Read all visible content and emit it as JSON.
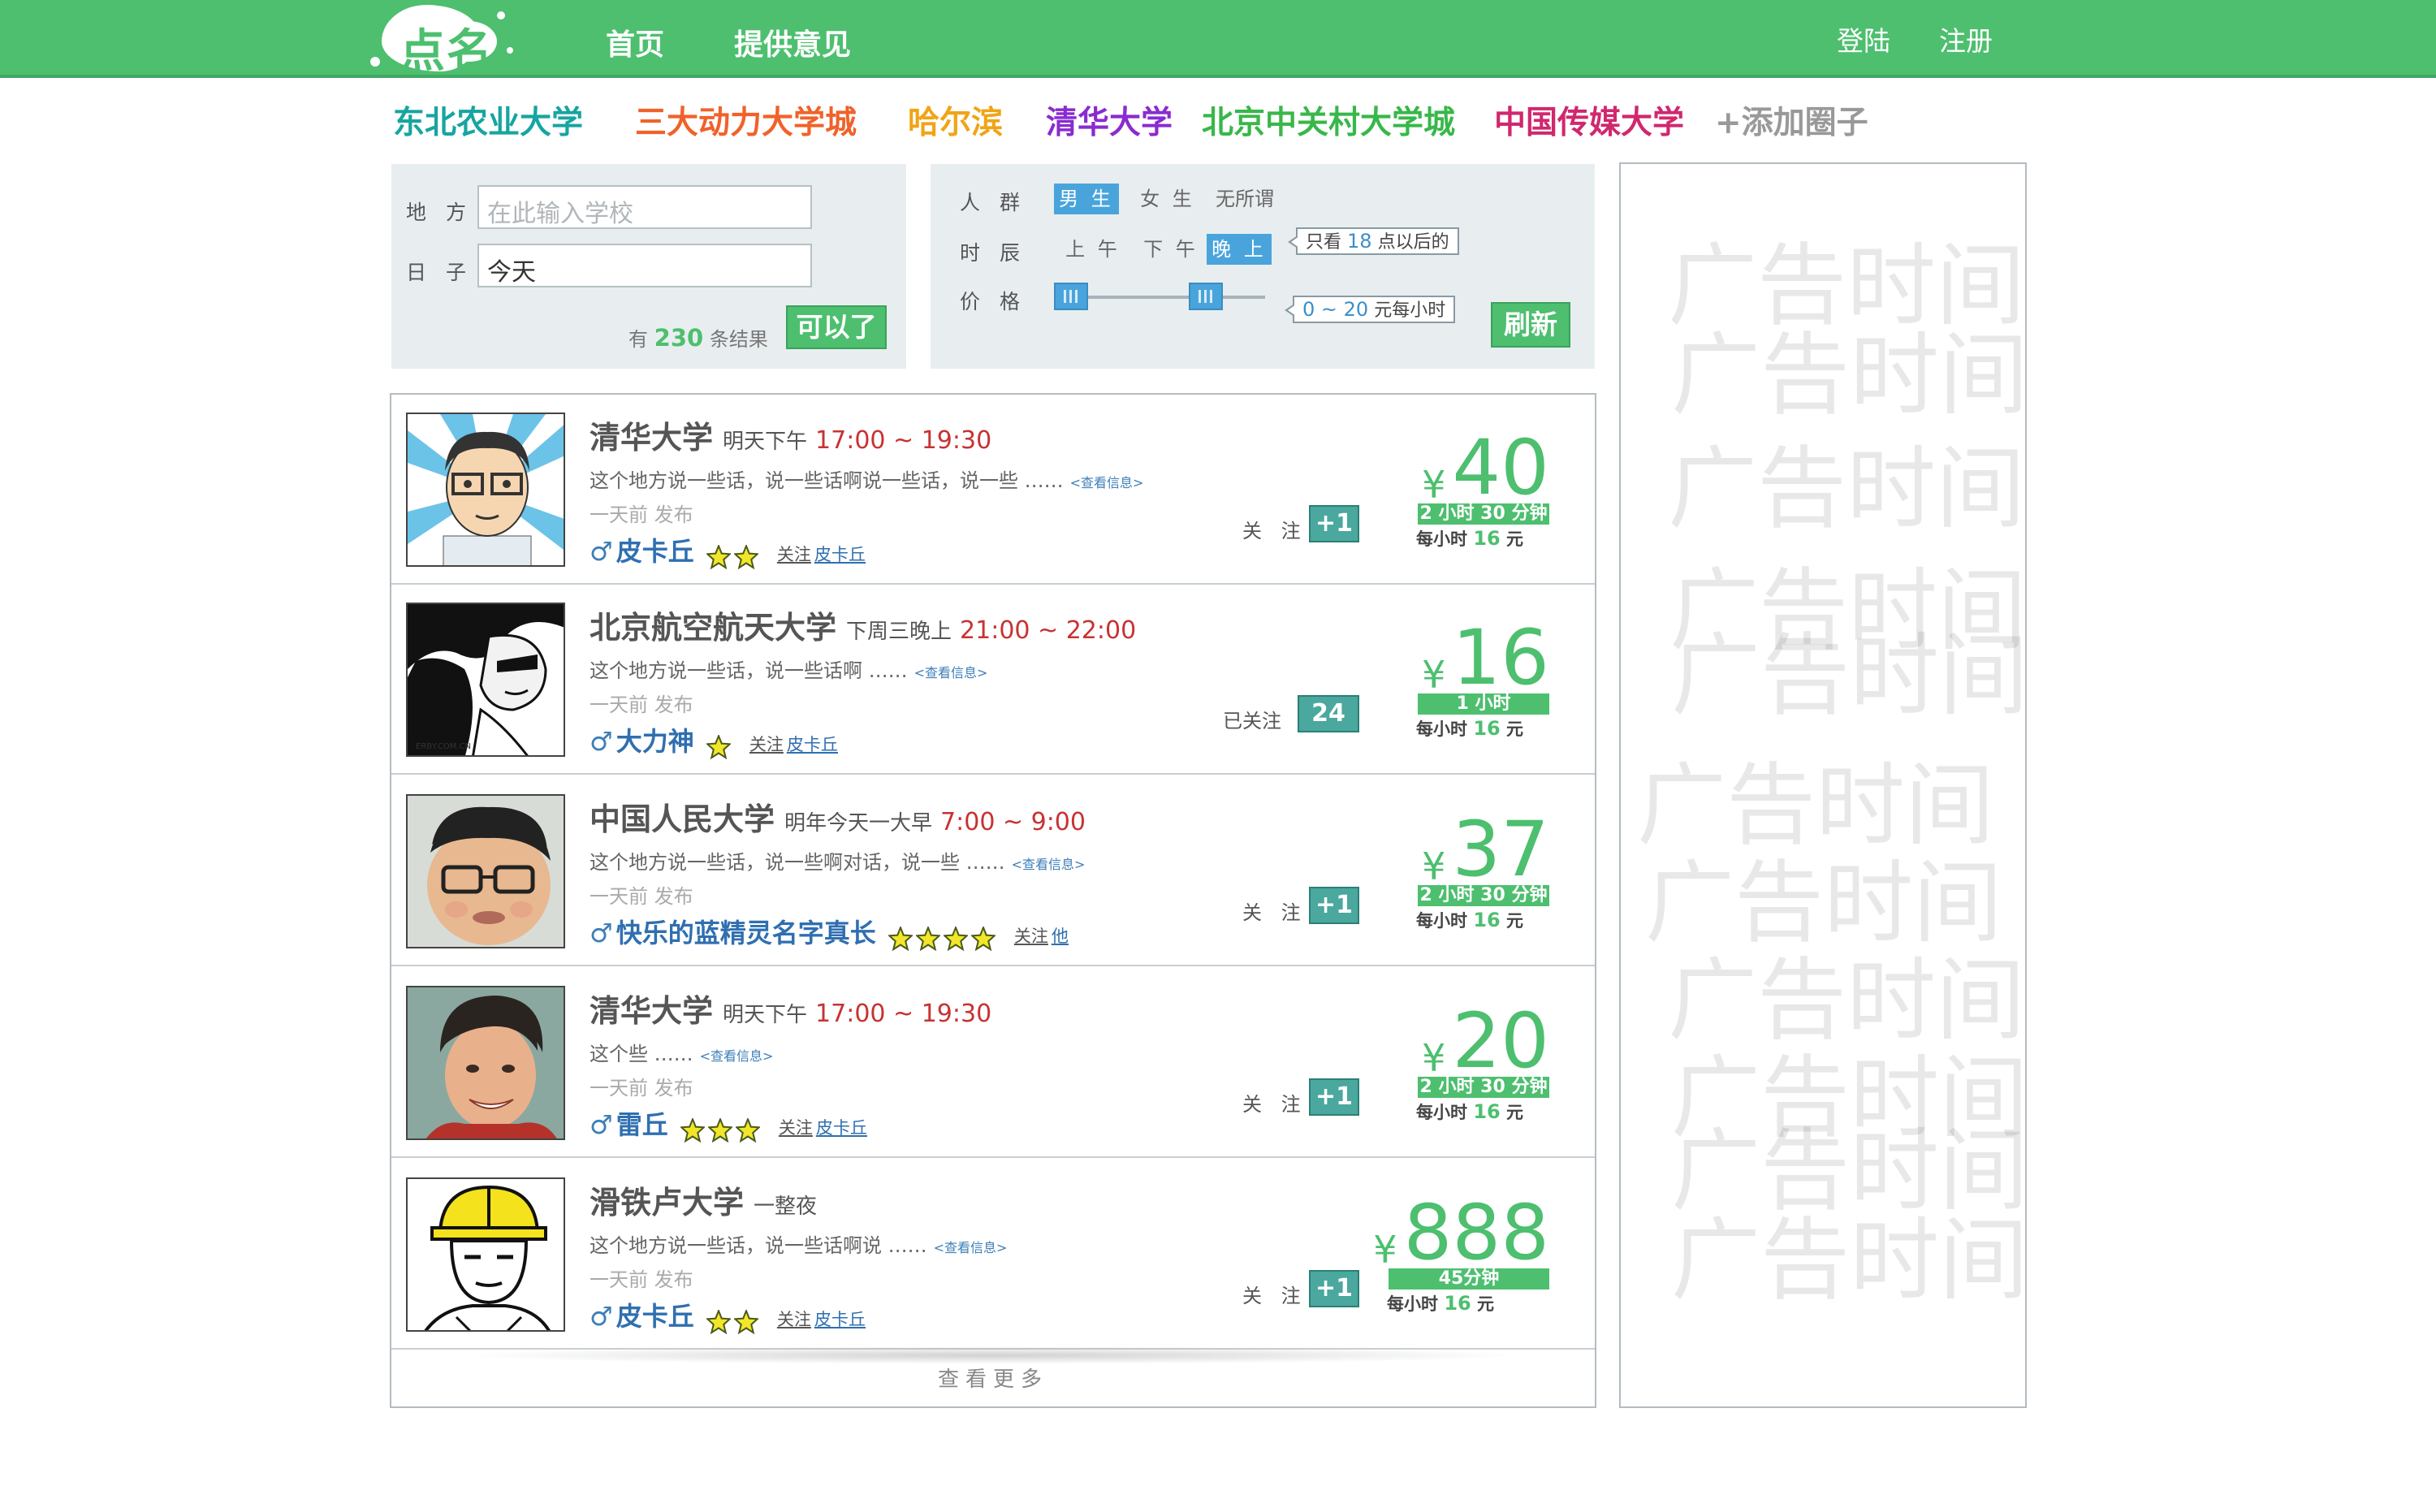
{
  "header": {
    "logo_text": "点名",
    "nav": [
      "首页",
      "提供意见"
    ],
    "login": "登陆",
    "register": "注册"
  },
  "circles": [
    {
      "label": "东北农业大学",
      "color": "#17a5a0"
    },
    {
      "label": "三大动力大学城",
      "color": "#f0622a"
    },
    {
      "label": "哈尔滨",
      "color": "#f0a416"
    },
    {
      "label": "清华大学",
      "color": "#8a2bd0"
    },
    {
      "label": "北京中关村大学城",
      "color": "#38b74a"
    },
    {
      "label": "中国传媒大学",
      "color": "#d0286e"
    },
    {
      "label": "+添加圈子",
      "color": "#999999"
    }
  ],
  "filter_left": {
    "place_label": "地 方",
    "place_placeholder": "在此输入学校",
    "day_label": "日 子",
    "day_value": "今天",
    "results_prefix": "有",
    "results_count": "230",
    "results_suffix": "条结果",
    "submit": "可以了"
  },
  "filter_right": {
    "group_label": "人 群",
    "group_options": [
      "男 生",
      "女 生",
      "无所谓"
    ],
    "group_active": "男 生",
    "time_label": "时 辰",
    "time_options": [
      "上 午",
      "下 午",
      "晚 上"
    ],
    "time_active": "晚 上",
    "time_hint_prefix": "只看",
    "time_hint_num": "18",
    "time_hint_suffix": "点以后的",
    "price_label": "价 格",
    "price_range": [
      0,
      20
    ],
    "price_range_text": "0 ~ 20",
    "price_unit": "元每小时",
    "refresh": "刷新"
  },
  "listings": [
    {
      "school": "清华大学",
      "when": "明天下午",
      "time": "17:00 ~ 19:30",
      "desc": "这个地方说一些话，说一些话啊说一些话，说一些 ……",
      "more_info": "<查看信息>",
      "posted": "一天前 发布",
      "gender": "♂",
      "nick": "皮卡丘",
      "stars": 2,
      "follow_user_prefix": "关注",
      "follow_user": "皮卡丘",
      "follow_label": "关 注",
      "follow_btn": "+1",
      "price": "40",
      "duration": "2 小时 30 分钟",
      "per_hour_prefix": "每小时",
      "per_hour": "16",
      "per_hour_unit": "元"
    },
    {
      "school": "北京航空航天大学",
      "when": "下周三晚上",
      "time": "21:00 ~ 22:00",
      "desc": "这个地方说一些话，说一些话啊 ……",
      "more_info": "<查看信息>",
      "posted": "一天前 发布",
      "gender": "♂",
      "nick": "大力神",
      "stars": 1,
      "follow_user_prefix": "关注",
      "follow_user": "皮卡丘",
      "follow_label": "已关注",
      "follow_btn": "24",
      "price": "16",
      "duration": "1 小时",
      "per_hour_prefix": "每小时",
      "per_hour": "16",
      "per_hour_unit": "元"
    },
    {
      "school": "中国人民大学",
      "when": "明年今天一大早",
      "time": "7:00 ~ 9:00",
      "desc": "这个地方说一些话，说一些啊对话，说一些 ……",
      "more_info": "<查看信息>",
      "posted": "一天前 发布",
      "gender": "♂",
      "nick": "快乐的蓝精灵名字真长",
      "stars": 4,
      "follow_user_prefix": "关注",
      "follow_user": "他",
      "follow_label": "关 注",
      "follow_btn": "+1",
      "price": "37",
      "duration": "2 小时 30 分钟",
      "per_hour_prefix": "每小时",
      "per_hour": "16",
      "per_hour_unit": "元"
    },
    {
      "school": "清华大学",
      "when": "明天下午",
      "time": "17:00 ~ 19:30",
      "desc": "这个些 ……",
      "more_info": "<查看信息>",
      "posted": "一天前 发布",
      "gender": "♂",
      "nick": "雷丘",
      "stars": 3,
      "follow_user_prefix": "关注",
      "follow_user": "皮卡丘",
      "follow_label": "关 注",
      "follow_btn": "+1",
      "price": "20",
      "duration": "2 小时 30 分钟",
      "per_hour_prefix": "每小时",
      "per_hour": "16",
      "per_hour_unit": "元"
    },
    {
      "school": "滑铁卢大学",
      "when": "一整夜",
      "time": "",
      "desc": "这个地方说一些话，说一些话啊说 ……",
      "more_info": "<查看信息>",
      "posted": "一天前 发布",
      "gender": "♂",
      "nick": "皮卡丘",
      "stars": 2,
      "follow_user_prefix": "关注",
      "follow_user": "皮卡丘",
      "follow_label": "关 注",
      "follow_btn": "+1",
      "price": "888",
      "duration": "45分钟",
      "per_hour_prefix": "每小时",
      "per_hour": "16",
      "per_hour_unit": "元"
    }
  ],
  "load_more": "查看更多",
  "ad_text": "广告时间",
  "colors": {
    "brand_green": "#4dbf6f",
    "accent_blue": "#4aa4dc",
    "time_red": "#c83232",
    "follow_teal": "#4aa89e"
  }
}
